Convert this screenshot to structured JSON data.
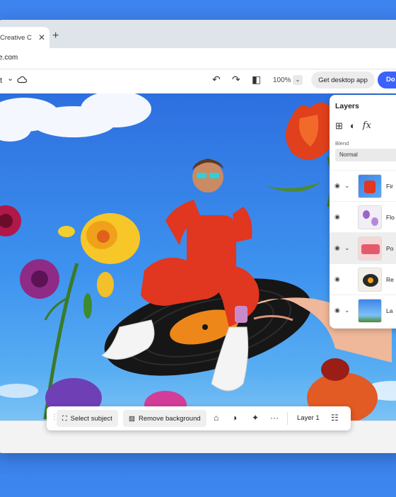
{
  "browser": {
    "tab_title": "Creative C",
    "tab_close_glyph": "✕",
    "new_tab_glyph": "+",
    "url": "e.com"
  },
  "toolbar": {
    "left_fragment": "t",
    "left_chevron": "⌄",
    "cloud_icon": "cloud-icon",
    "undo_glyph": "↶",
    "redo_glyph": "↷",
    "compare_glyph": "◧",
    "zoom": "100%",
    "zoom_dropdown": "⌄",
    "desktop_button": "Get desktop app",
    "download_button": "Do",
    "download_color": "#3b63fb"
  },
  "layers": {
    "title": "Layers",
    "tools": [
      "⊞",
      "◐",
      "fx"
    ],
    "blend_label": "Blend",
    "blend_value": "Normal",
    "items": [
      {
        "name": "Fir",
        "has_chevron": true,
        "selected": false
      },
      {
        "name": "Flo",
        "has_chevron": false,
        "selected": false
      },
      {
        "name": "Po",
        "has_chevron": true,
        "selected": true
      },
      {
        "name": "Re",
        "has_chevron": false,
        "selected": false
      },
      {
        "name": "La",
        "has_chevron": true,
        "selected": false
      }
    ],
    "eye_glyph": "◉",
    "chevron_glyph": "⌄"
  },
  "context_bar": {
    "grip_glyph": "⋮",
    "select_subject": "Select subject",
    "remove_background": "Remove background",
    "more_glyph": "···",
    "layer_label": "Layer 1",
    "settings_glyph": "☷"
  }
}
